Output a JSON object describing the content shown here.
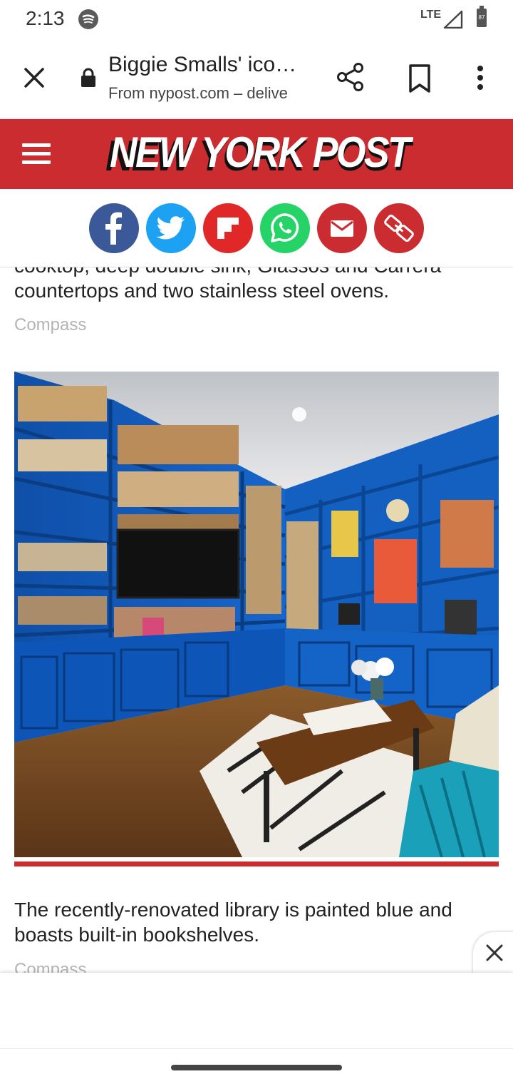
{
  "status": {
    "time": "2:13",
    "network": "LTE",
    "battery": "87"
  },
  "toolbar": {
    "title": "Biggie Smalls' ico…",
    "url": "From nypost.com – delive"
  },
  "header": {
    "logo_text": "NEW YORK POST",
    "brand_color": "#cb2c30"
  },
  "share": {
    "buttons": [
      {
        "name": "facebook",
        "color": "#3b5998"
      },
      {
        "name": "twitter",
        "color": "#1da1f2"
      },
      {
        "name": "flipboard",
        "color": "#e12828"
      },
      {
        "name": "whatsapp",
        "color": "#25d366"
      },
      {
        "name": "email",
        "color": "#cb2c30"
      },
      {
        "name": "copy-link",
        "color": "#cb2c30"
      }
    ]
  },
  "article": {
    "prev_caption_partial": "cooktop, deep double sink, Glassos and Carrera",
    "prev_caption_end": "countertops and two stainless steel ovens.",
    "prev_credit": "Compass",
    "photo_alt": "Blue library room with built-in bookshelves",
    "caption": "The recently-renovated library is painted blue and boasts built-in bookshelves.",
    "credit": "Compass"
  }
}
